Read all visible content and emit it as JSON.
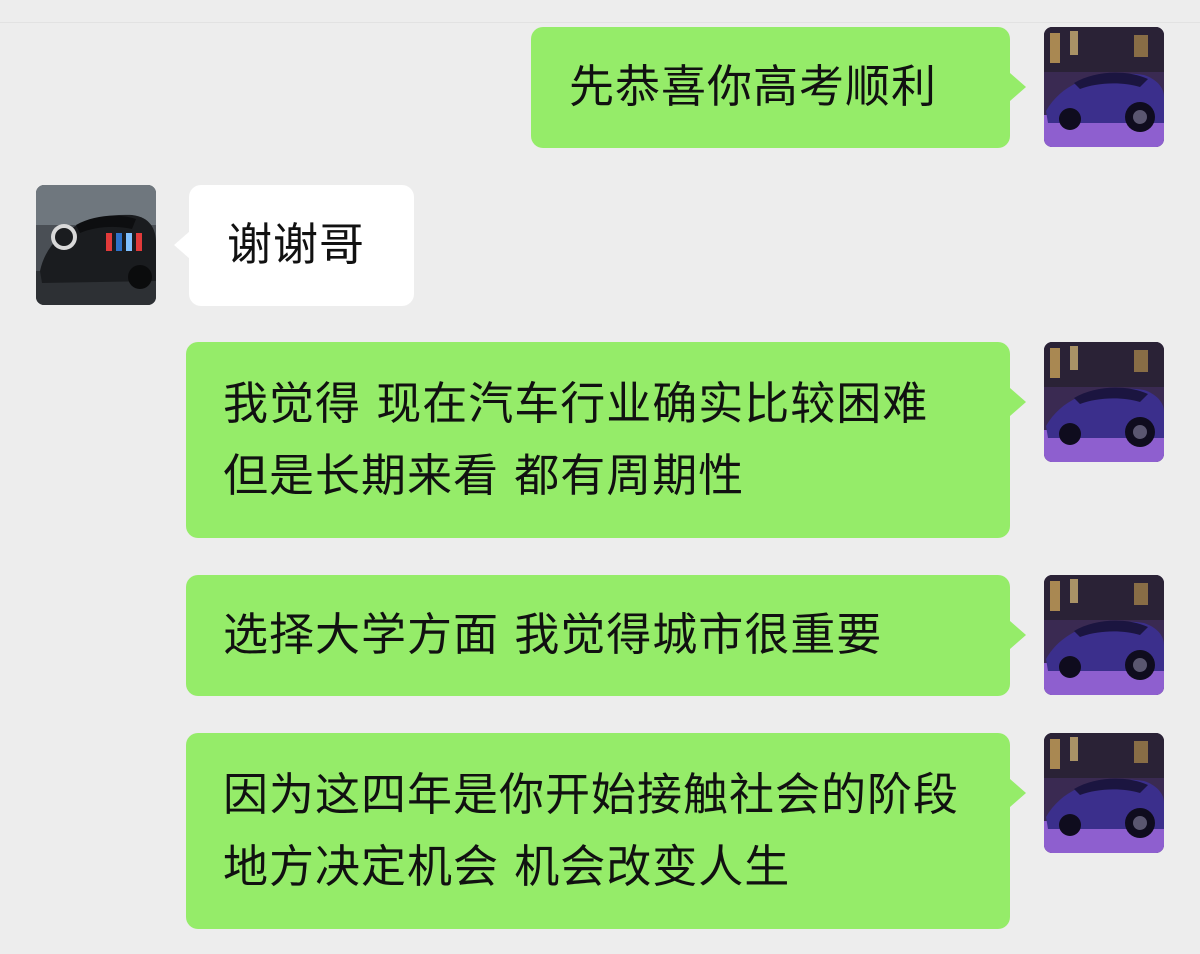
{
  "chat": {
    "messages": [
      {
        "side": "right",
        "text": "先恭喜你高考顺利",
        "avatar": "purple-supercar-avatar"
      },
      {
        "side": "left",
        "text": "谢谢哥",
        "avatar": "black-racecar-avatar"
      },
      {
        "side": "right",
        "text": "我觉得 现在汽车行业确实比较困难 但是长期来看 都有周期性",
        "avatar": "purple-supercar-avatar"
      },
      {
        "side": "right",
        "text": "选择大学方面 我觉得城市很重要",
        "avatar": "purple-supercar-avatar"
      },
      {
        "side": "right",
        "text": "因为这四年是你开始接触社会的阶段 地方决定机会 机会改变人生",
        "avatar": "purple-supercar-avatar"
      }
    ]
  },
  "colors": {
    "background": "#ededed",
    "sent_bubble": "#95ec69",
    "received_bubble": "#ffffff",
    "text": "#111111"
  }
}
